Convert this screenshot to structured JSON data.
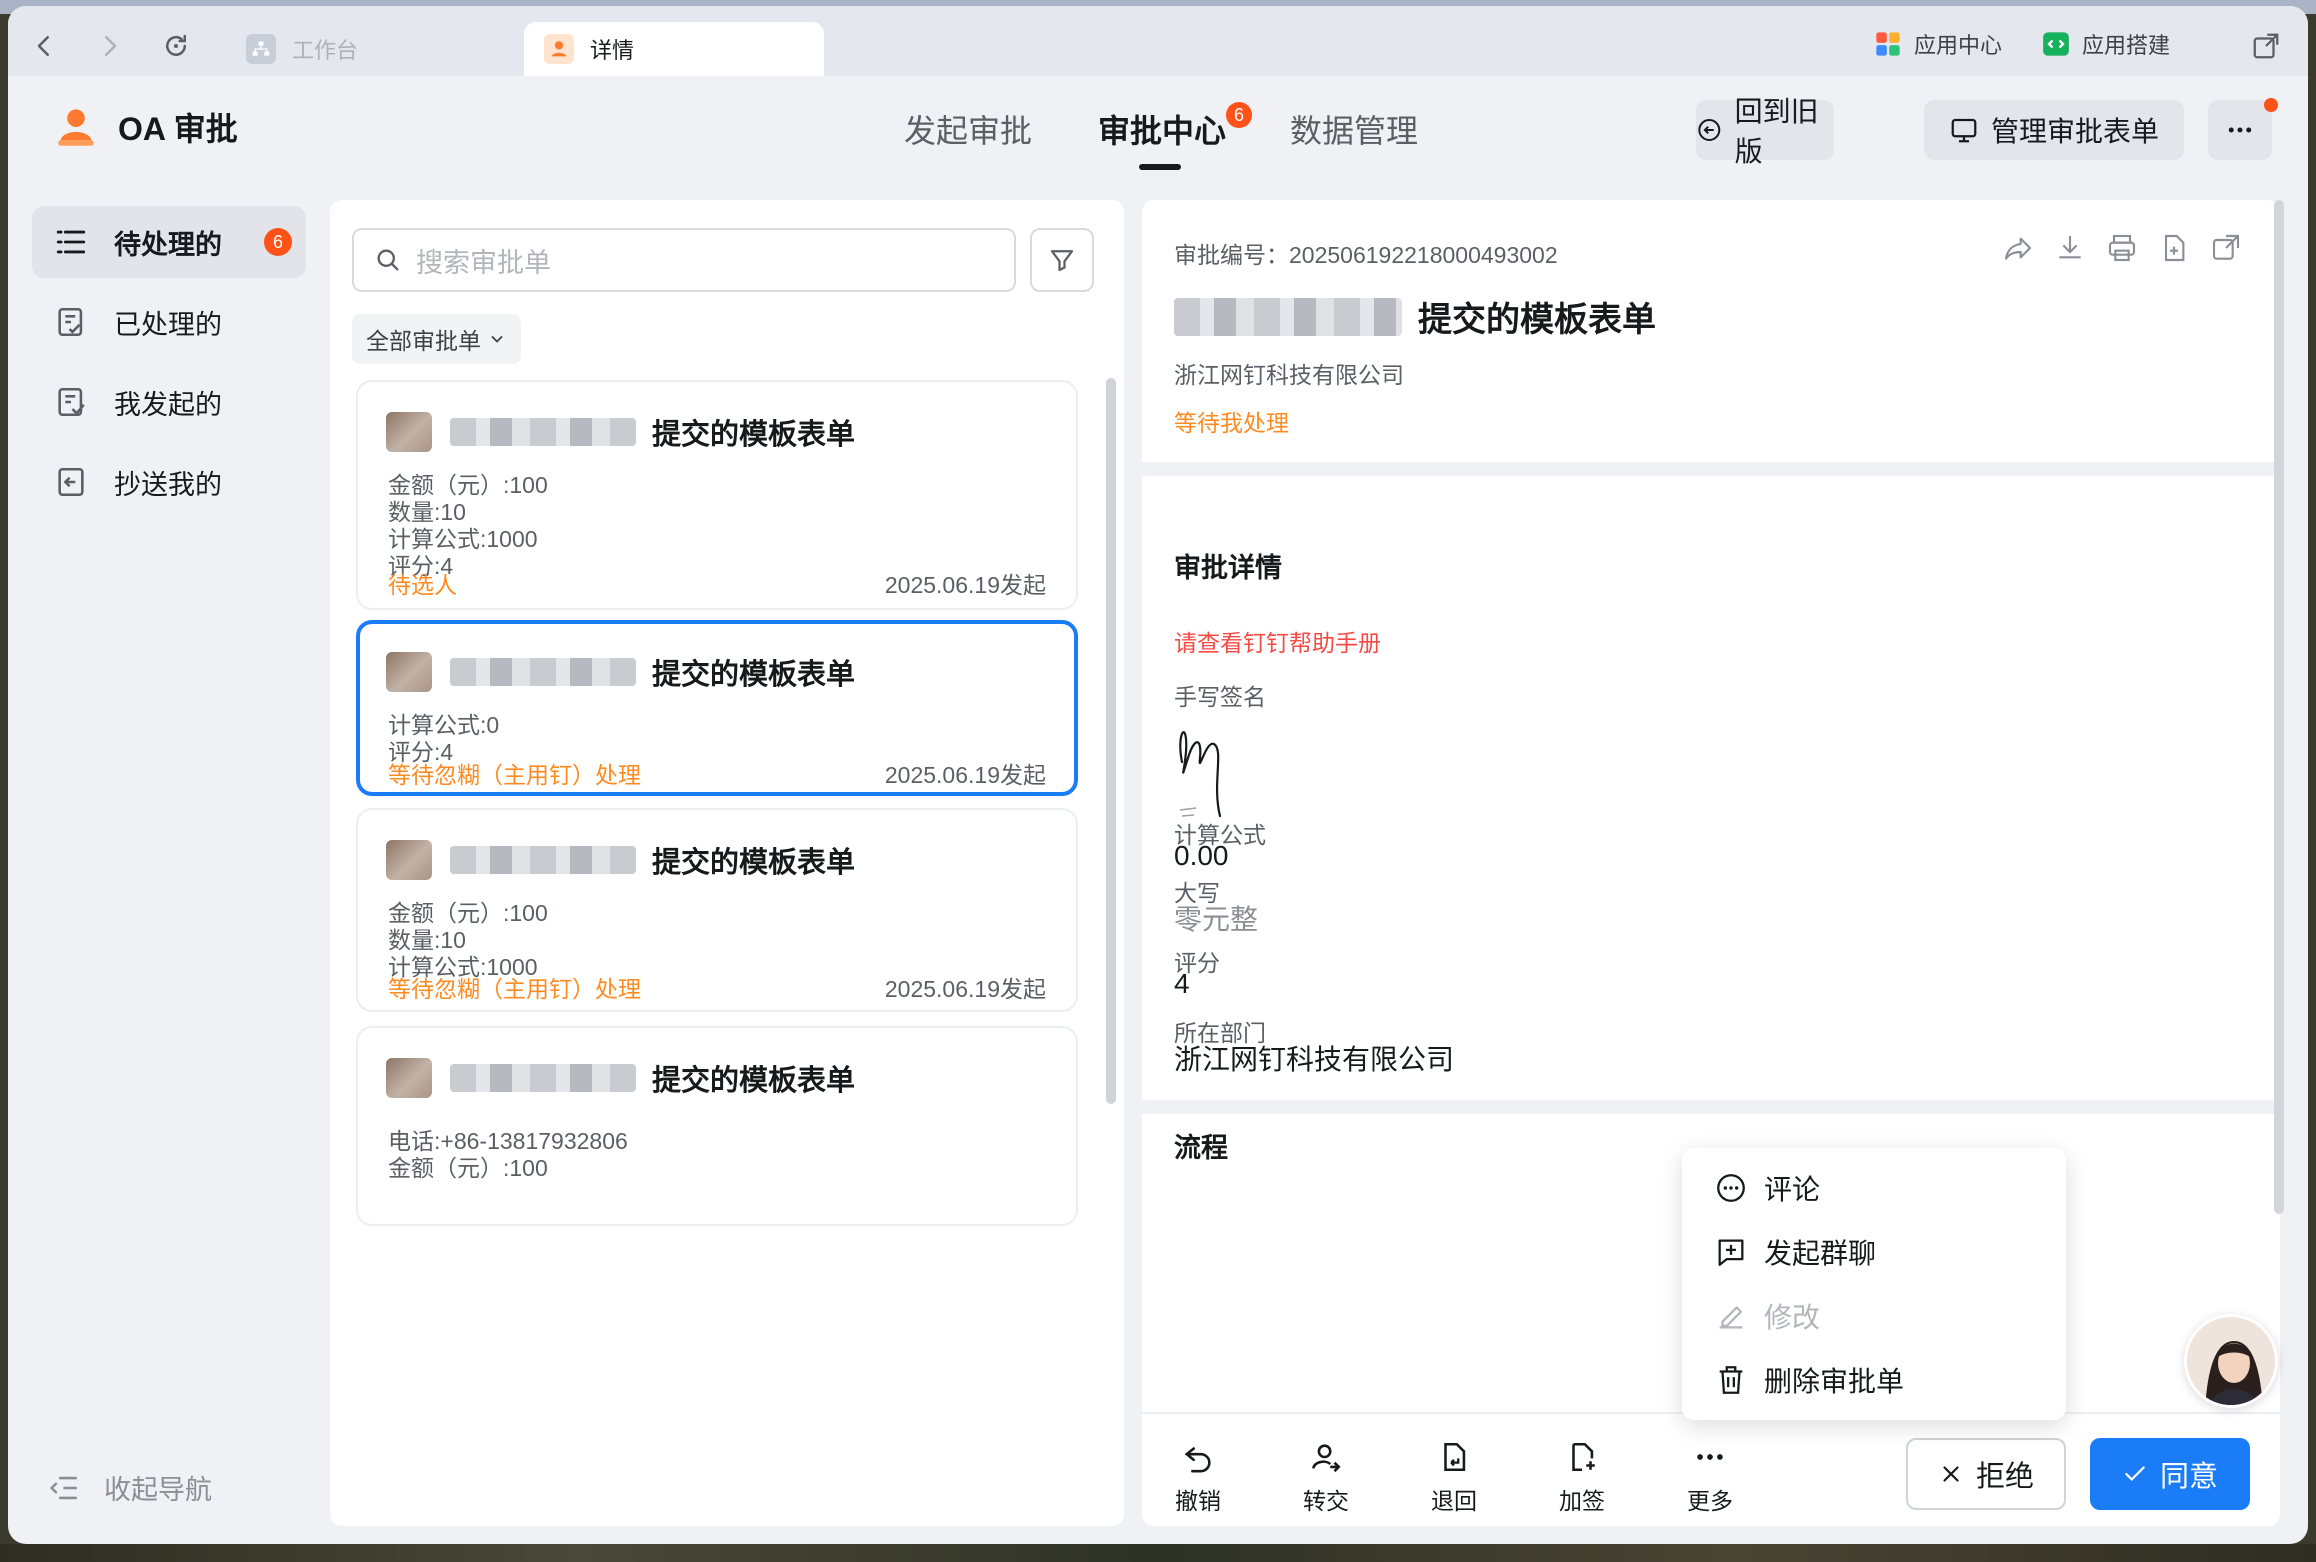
{
  "titlebar": {
    "tabs": [
      {
        "label": "工作台",
        "icon": "org-chart-icon"
      },
      {
        "label": "详情",
        "icon": "oa-app-icon"
      }
    ],
    "right": [
      {
        "label": "应用中心",
        "icon": "app-center-icon"
      },
      {
        "label": "应用搭建",
        "icon": "app-build-icon"
      }
    ]
  },
  "header": {
    "app_name": "OA 审批",
    "nav": [
      {
        "label": "发起审批"
      },
      {
        "label": "审批中心",
        "badge": "6"
      },
      {
        "label": "数据管理"
      }
    ],
    "back_old": "回到旧版",
    "manage_forms": "管理审批表单"
  },
  "sidebar": {
    "items": [
      {
        "label": "待处理的",
        "badge": "6"
      },
      {
        "label": "已处理的"
      },
      {
        "label": "我发起的"
      },
      {
        "label": "抄送我的"
      }
    ],
    "collapse": "收起导航"
  },
  "list": {
    "search_placeholder": "搜索审批单",
    "filter_dropdown": "全部审批单",
    "cards": [
      {
        "title": "提交的模板表单",
        "fields": [
          "金额（元）:100",
          "数量:10",
          "计算公式:1000",
          "评分:4"
        ],
        "status": "待选人",
        "date": "2025.06.19发起"
      },
      {
        "title": "提交的模板表单",
        "fields": [
          "计算公式:0",
          "评分:4"
        ],
        "status": "等待忽糊（主用钉）处理",
        "date": "2025.06.19发起"
      },
      {
        "title": "提交的模板表单",
        "fields": [
          "金额（元）:100",
          "数量:10",
          "计算公式:1000"
        ],
        "status": "等待忽糊（主用钉）处理",
        "date": "2025.06.19发起"
      },
      {
        "title": "提交的模板表单",
        "fields": [
          "电话:+86-13817932806",
          "金额（元）:100"
        ],
        "status": "",
        "date": ""
      }
    ]
  },
  "detail": {
    "approval_no": "审批编号：202506192218000493002",
    "title": "提交的模板表单",
    "company": "浙江网钉科技有限公司",
    "status": "等待我处理",
    "section_detail": "审批详情",
    "help_link": "请查看钉钉帮助手册",
    "signature_label": "手写签名",
    "formula_label": "计算公式",
    "formula_value": "0.00",
    "capital_label": "大写",
    "capital_value": "零元整",
    "score_label": "评分",
    "score_value": "4",
    "dept_label": "所在部门",
    "dept_value": "浙江网钉科技有限公司",
    "section_flow": "流程"
  },
  "actions": {
    "revoke": "撤销",
    "transfer": "转交",
    "return": "退回",
    "add_sign": "加签",
    "more": "更多",
    "reject": "拒绝",
    "agree": "同意"
  },
  "more_menu": [
    {
      "label": "评论",
      "icon": "comment-icon",
      "disabled": false
    },
    {
      "label": "发起群聊",
      "icon": "group-chat-icon",
      "disabled": false
    },
    {
      "label": "修改",
      "icon": "edit-icon",
      "disabled": true
    },
    {
      "label": "删除审批单",
      "icon": "trash-icon",
      "disabled": false
    }
  ],
  "colors": {
    "accent": "#1b7cf7",
    "badge": "#ff5219",
    "pending": "#ff8a1f",
    "link_red": "#f54a45"
  }
}
